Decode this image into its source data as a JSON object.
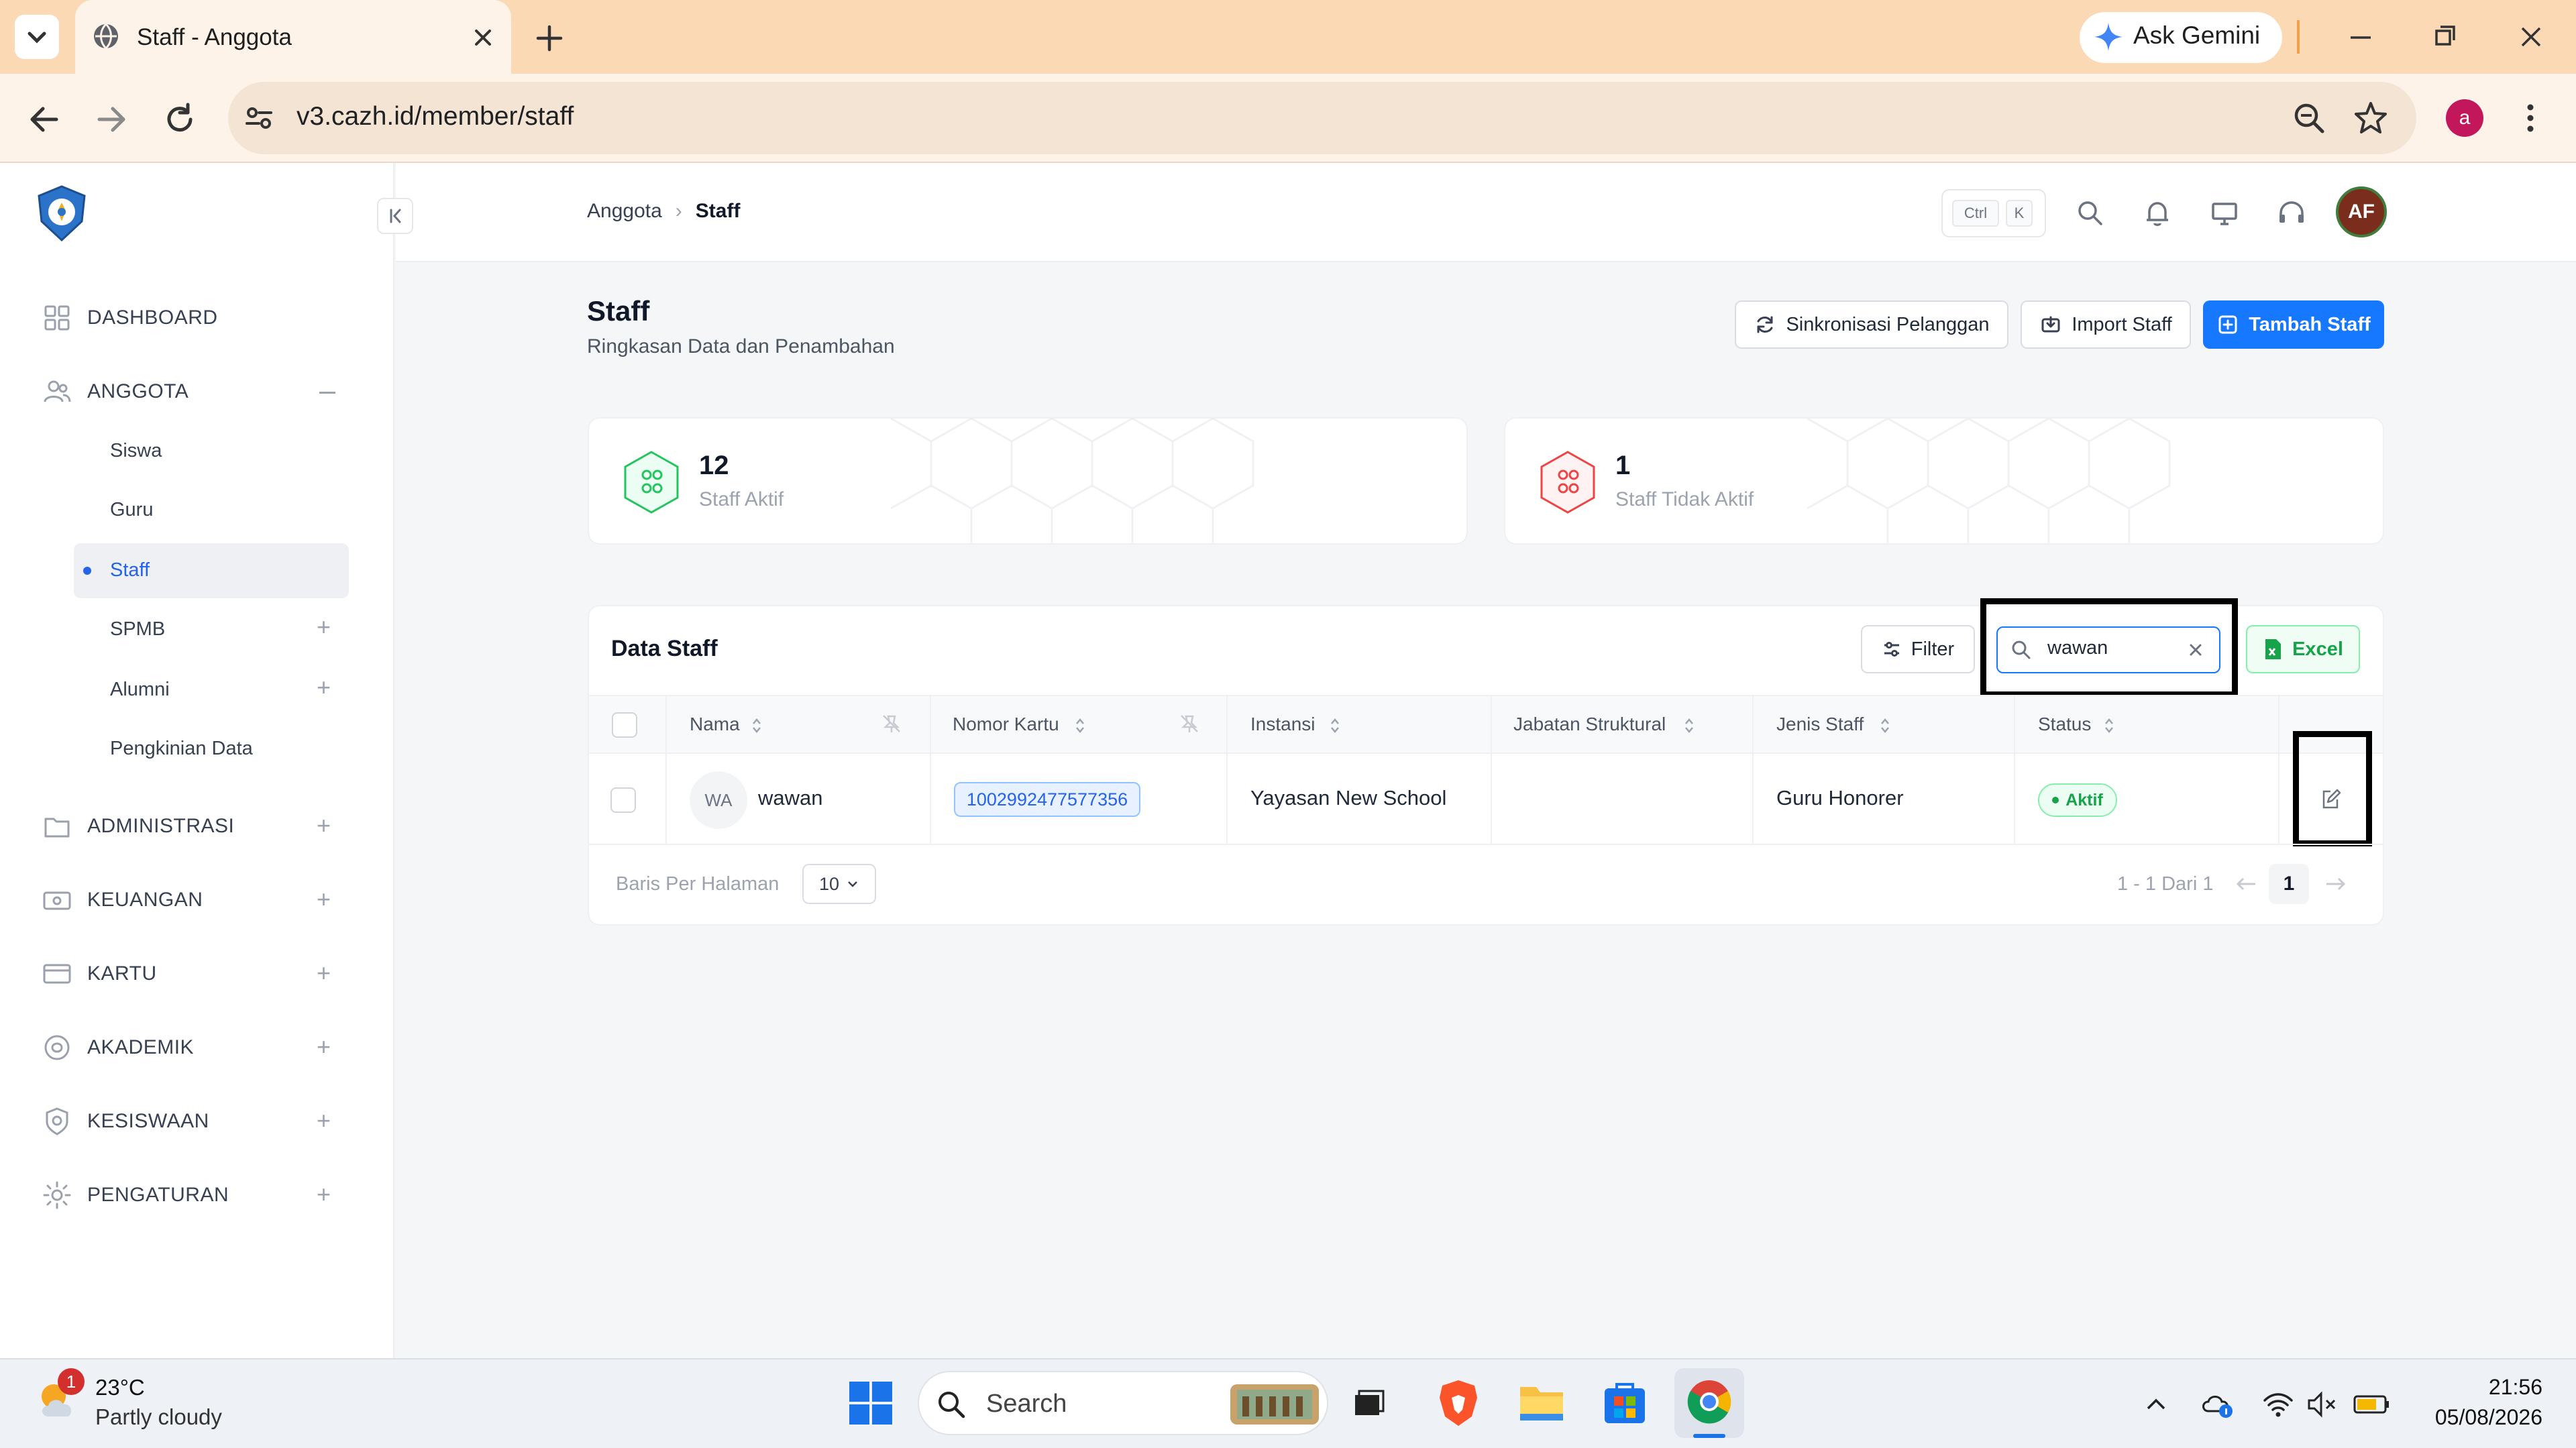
{
  "browser": {
    "tab_title": "Staff - Anggota",
    "url": "v3.cazh.id/member/staff",
    "gemini_label": "Ask Gemini",
    "profile_initial": "a"
  },
  "sidebar": {
    "menu": [
      {
        "label": "DASHBOARD",
        "icon": "grid-icon"
      },
      {
        "label": "ANGGOTA",
        "icon": "users-icon"
      },
      {
        "label": "ADMINISTRASI",
        "icon": "folder-icon"
      },
      {
        "label": "KEUANGAN",
        "icon": "money-icon"
      },
      {
        "label": "KARTU",
        "icon": "card-icon"
      },
      {
        "label": "AKADEMIK",
        "icon": "graduation-icon"
      },
      {
        "label": "KESISWAAN",
        "icon": "student-icon"
      },
      {
        "label": "PENGATURAN",
        "icon": "gear-icon"
      }
    ],
    "anggota_sub": [
      "Siswa",
      "Guru",
      "Staff",
      "SPMB",
      "Alumni",
      "Pengkinian Data"
    ]
  },
  "header": {
    "breadcrumb_parent": "Anggota",
    "breadcrumb_sep": "›",
    "breadcrumb_current": "Staff",
    "kbd_ctrl": "Ctrl",
    "kbd_k": "K",
    "user_initials": "AF"
  },
  "page": {
    "title": "Staff",
    "subtitle": "Ringkasan Data dan Penambahan",
    "btn_sync": "Sinkronisasi Pelanggan",
    "btn_import": "Import Staff",
    "btn_add": "Tambah Staff"
  },
  "stats": [
    {
      "value": "12",
      "label": "Staff Aktif",
      "color": "#22c55e"
    },
    {
      "value": "1",
      "label": "Staff Tidak Aktif",
      "color": "#ef4444"
    }
  ],
  "table": {
    "title": "Data Staff",
    "filter_label": "Filter",
    "search_value": "wawan",
    "excel_label": "Excel",
    "columns": [
      "Nama",
      "Nomor Kartu",
      "Instansi",
      "Jabatan Struktural",
      "Jenis Staff",
      "Status"
    ],
    "rows": [
      {
        "initials": "WA",
        "name": "wawan",
        "card_number": "1002992477577356",
        "instansi": "Yayasan New School",
        "jabatan": "",
        "jenis": "Guru Honorer",
        "status": "Aktif"
      }
    ],
    "rows_per_page_label": "Baris Per Halaman",
    "rows_per_page": "10",
    "pager_info": "1 - 1 Dari 1",
    "current_page": "1"
  },
  "taskbar": {
    "weather_temp": "23°C",
    "weather_desc": "Partly cloudy",
    "weather_badge": "1",
    "search_label": "Search",
    "time": "21:56",
    "date": "05/08/2026"
  },
  "colors": {
    "primary": "#1677ff",
    "success": "#16a34a",
    "danger": "#ef4444",
    "tabbar": "#fbd9b5"
  }
}
